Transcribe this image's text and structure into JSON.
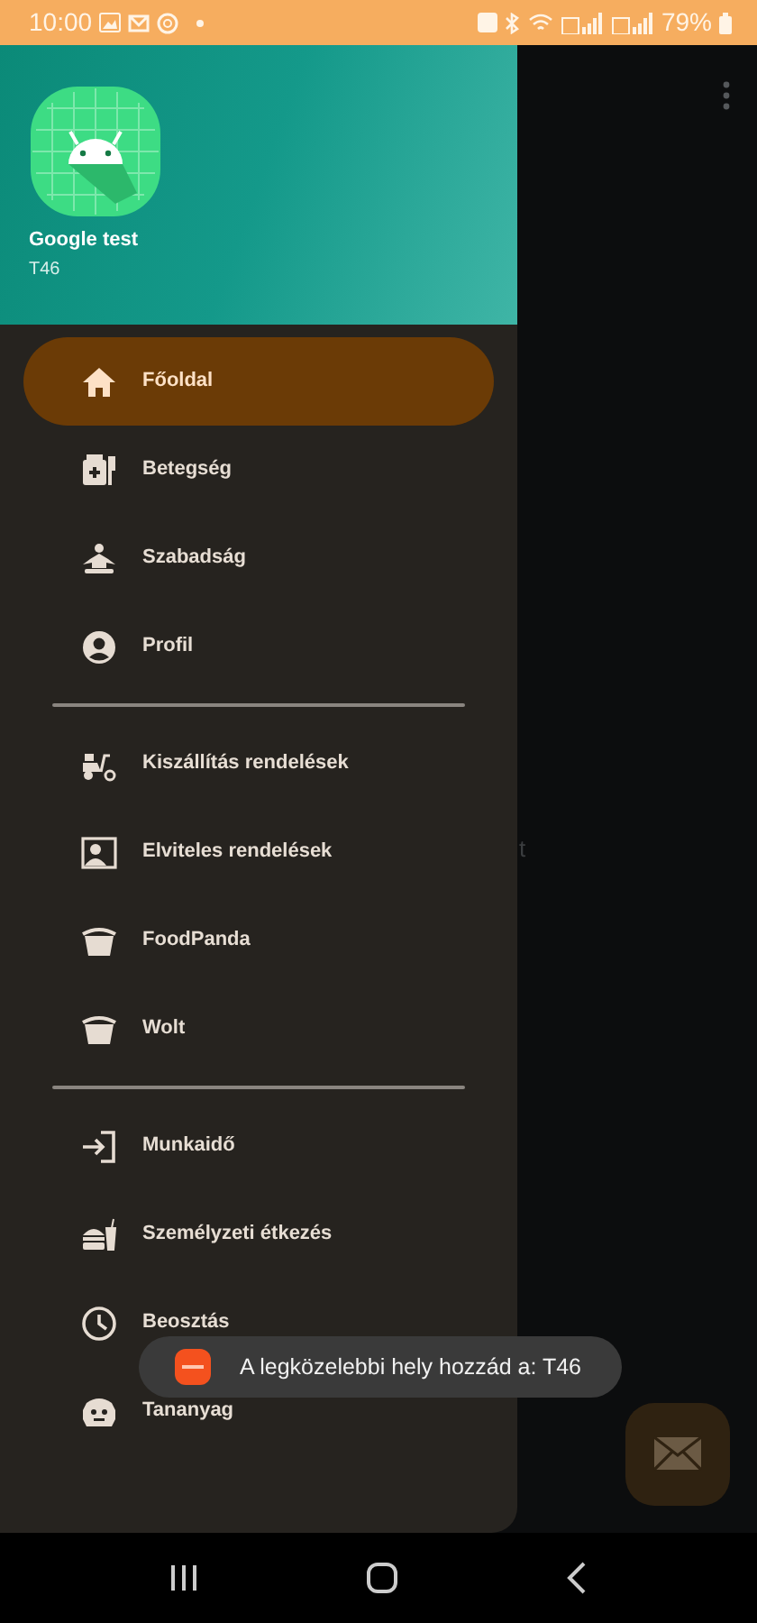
{
  "status_bar": {
    "time": "10:00",
    "battery": "79%"
  },
  "drawer": {
    "header": {
      "title": "Google test",
      "subtitle": "T46"
    },
    "sections": [
      {
        "items": [
          {
            "label": "Főoldal",
            "selected": true
          },
          {
            "label": "Betegség",
            "selected": false
          },
          {
            "label": "Szabadság",
            "selected": false
          },
          {
            "label": "Profil",
            "selected": false
          }
        ]
      },
      {
        "items": [
          {
            "label": "Kiszállítás rendelések",
            "selected": false
          },
          {
            "label": "Elviteles rendelések",
            "selected": false
          },
          {
            "label": "FoodPanda",
            "selected": false
          },
          {
            "label": "Wolt",
            "selected": false
          }
        ]
      },
      {
        "items": [
          {
            "label": "Munkaidő",
            "selected": false
          },
          {
            "label": "Személyzeti étkezés",
            "selected": false
          },
          {
            "label": "Beosztás",
            "selected": false
          },
          {
            "label": "Tananyag",
            "selected": false
          }
        ]
      }
    ]
  },
  "background_text": "t",
  "toast": {
    "text": "A legközelebbi hely hozzád a: T46"
  }
}
